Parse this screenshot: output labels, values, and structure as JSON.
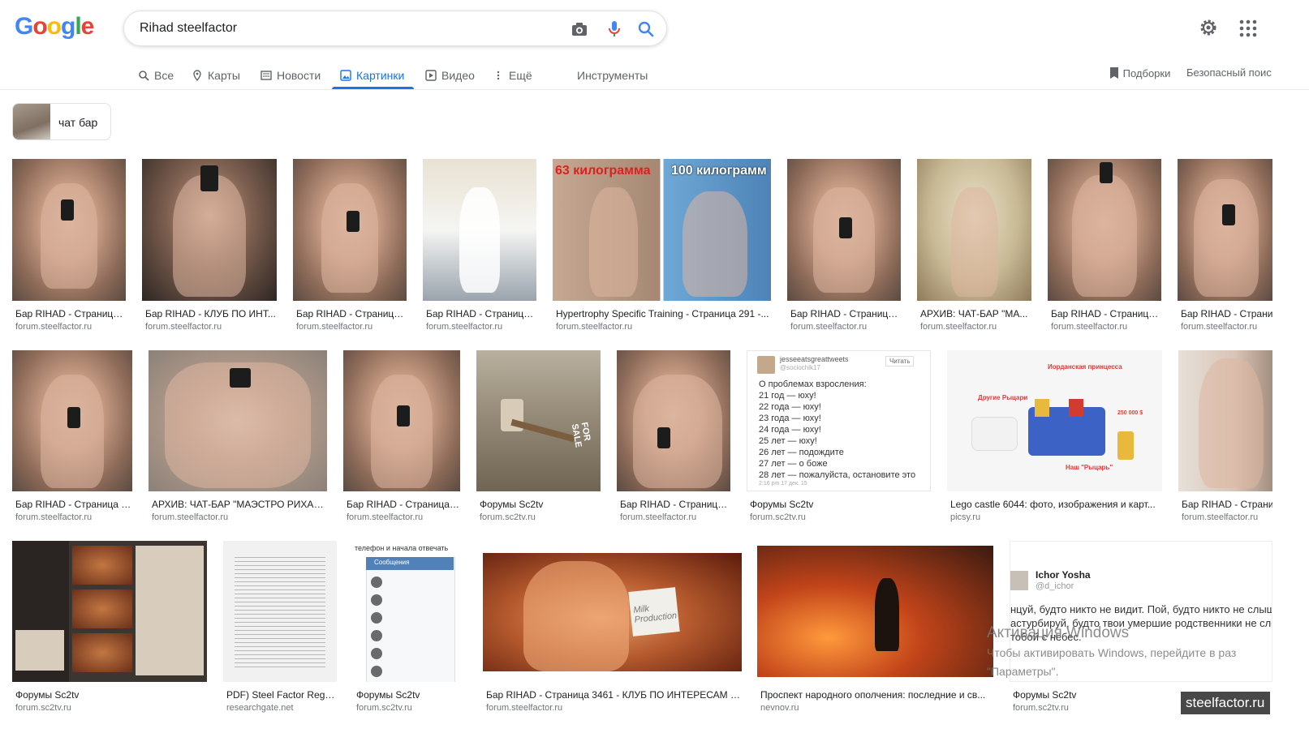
{
  "logo": {
    "letters": [
      "G",
      "o",
      "o",
      "g",
      "l",
      "e"
    ],
    "colors": [
      "#4285F4",
      "#EA4335",
      "#FBBC05",
      "#4285F4",
      "#34A853",
      "#EA4335"
    ]
  },
  "search": {
    "query": "Rihad steelfactor",
    "icons": [
      "camera-icon",
      "mic-icon",
      "search-icon"
    ]
  },
  "header_icons": [
    "gear-icon",
    "apps-grid-icon"
  ],
  "tabs": [
    {
      "label": "Все",
      "icon": "search-icon"
    },
    {
      "label": "Карты",
      "icon": "pin-icon"
    },
    {
      "label": "Новости",
      "icon": "news-icon"
    },
    {
      "label": "Картинки",
      "icon": "image-icon",
      "active": true
    },
    {
      "label": "Видео",
      "icon": "play-icon"
    },
    {
      "label": "Ещё",
      "icon": "more-vert-icon"
    }
  ],
  "tools_label": "Инструменты",
  "collections_label": "Подборки",
  "safesearch_label": "Безопасный поис",
  "chip": {
    "label": "чат бар"
  },
  "results": [
    {
      "cap": "Бар RIHAD - Страница...",
      "src": "forum.steelfactor.ru"
    },
    {
      "cap": "Бар RIHAD - КЛУБ ПО ИНТ...",
      "src": "forum.steelfactor.ru"
    },
    {
      "cap": "Бар RIHAD - Страница...",
      "src": "forum.steelfactor.ru"
    },
    {
      "cap": "Бар RIHAD - Страница...",
      "src": "forum.steelfactor.ru"
    },
    {
      "cap": "Hypertrophy Specific Training - Страница 291 -...",
      "src": "forum.steelfactor.ru",
      "overlay_left": "63 килограмма",
      "overlay_right": "100 килограмм"
    },
    {
      "cap": "Бар RIHAD - Страница...",
      "src": "forum.steelfactor.ru"
    },
    {
      "cap": "АРХИВ: ЧАТ-БАР \"МА...",
      "src": "forum.steelfactor.ru"
    },
    {
      "cap": "Бар RIHAD - Страница...",
      "src": "forum.steelfactor.ru"
    },
    {
      "cap": "Бар RIHAD - Страни",
      "src": "forum.steelfactor.ru"
    },
    {
      "cap": "Бар RIHAD - Страница 7...",
      "src": "forum.steelfactor.ru"
    },
    {
      "cap": "АРХИВ: ЧАТ-БАР \"МАЭСТРО РИХАД\"...",
      "src": "forum.steelfactor.ru"
    },
    {
      "cap": "Бар RIHAD - Страница ...",
      "src": "forum.steelfactor.ru"
    },
    {
      "cap": "Форумы Sc2tv",
      "src": "forum.sc2tv.ru",
      "overlay_sign": "FOR SALE"
    },
    {
      "cap": "Бар RIHAD - Страница...",
      "src": "forum.steelfactor.ru"
    },
    {
      "cap": "Форумы Sc2tv",
      "src": "forum.sc2tv.ru"
    },
    {
      "cap": "Lego castle 6044: фото, изображения и карт...",
      "src": "picsy.ru",
      "overlay_top": "Иорданская принцесса",
      "overlay_left": "Другие Рыцари",
      "overlay_bottom": "Наш \"Рыцарь\"",
      "overlay_price": "250 000 $"
    },
    {
      "cap": "Бар RIHAD - Страни",
      "src": "forum.steelfactor.ru"
    },
    {
      "cap": "Форумы Sc2tv",
      "src": "forum.sc2tv.ru"
    },
    {
      "cap": "PDF) Steel Factor Regu...",
      "src": "researchgate.net"
    },
    {
      "cap": "Форумы Sc2tv",
      "src": "forum.sc2tv.ru",
      "overlay_top": "телефон и начала отвечать",
      "overlay_header": "Сообщения"
    },
    {
      "cap": "Бар RIHAD - Страница 3461 - КЛУБ ПО ИНТЕРЕСАМ - ...",
      "src": "forum.steelfactor.ru",
      "overlay_sign": "Milk Production"
    },
    {
      "cap": "Проспект народного ополчения: последние и св...",
      "src": "nevnov.ru"
    },
    {
      "cap": "Форумы Sc2tv",
      "src": "forum.sc2tv.ru"
    }
  ],
  "tweet": {
    "user": "jesseeatsgreattweets",
    "handle": "@sociochik17",
    "follow": "Читать",
    "lines": [
      "О проблемах взросления:",
      "21 год — юху!",
      "22 года — юху!",
      "23 года — юху!",
      "24 года — юху!",
      "25 лет — юху!",
      "26 лет — подождите",
      "27 лет — о боже",
      "28 лет — пожалуйста, остановите это"
    ],
    "time": "2:16 pm 17 дек. 15"
  },
  "tweet2": {
    "user": "Ichor Yosha",
    "handle": "@d_ichor",
    "lines": [
      "нцуй, будто никто не видит. Пой, будто никто не слыш",
      "астурбируй, будто твои умершие родственники не сле",
      "тобой с небес."
    ]
  },
  "windows_watermark": {
    "title": "Активация Windows",
    "line1": "Чтобы активировать Windows, перейдите в раз",
    "line2": "\"Параметры\"."
  },
  "banner": "steelfactor.ru"
}
